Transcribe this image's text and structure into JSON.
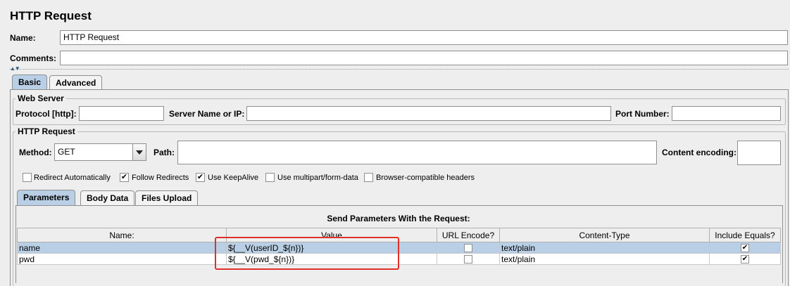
{
  "title": "HTTP Request",
  "name": {
    "label": "Name:",
    "value": "HTTP Request"
  },
  "comments": {
    "label": "Comments:",
    "value": ""
  },
  "tabs": [
    {
      "label": "Basic",
      "active": true
    },
    {
      "label": "Advanced",
      "active": false
    }
  ],
  "web_server": {
    "title": "Web Server",
    "protocol_label": "Protocol [http]:",
    "protocol_value": "",
    "server_label": "Server Name or IP:",
    "server_value": "",
    "port_label": "Port Number:",
    "port_value": ""
  },
  "http_request": {
    "title": "HTTP Request",
    "method_label": "Method:",
    "method_value": "GET",
    "path_label": "Path:",
    "path_value": "",
    "encoding_label": "Content encoding:",
    "encoding_value": ""
  },
  "options": [
    {
      "label": "Redirect Automatically",
      "checked": false
    },
    {
      "label": "Follow Redirects",
      "checked": true
    },
    {
      "label": "Use KeepAlive",
      "checked": true
    },
    {
      "label": "Use multipart/form-data",
      "checked": false
    },
    {
      "label": "Browser-compatible headers",
      "checked": false
    }
  ],
  "sub_tabs": [
    {
      "label": "Parameters",
      "active": true
    },
    {
      "label": "Body Data",
      "active": false
    },
    {
      "label": "Files Upload",
      "active": false
    }
  ],
  "params": {
    "heading": "Send Parameters With the Request:",
    "columns": [
      "Name:",
      "Value",
      "URL Encode?",
      "Content-Type",
      "Include Equals?"
    ],
    "rows": [
      {
        "name": "name",
        "value": "${__V(userID_${n})}",
        "url_encode": false,
        "content_type": "text/plain",
        "include_equals": true
      },
      {
        "name": "pwd",
        "value": "${__V(pwd_${n})}",
        "url_encode": false,
        "content_type": "text/plain",
        "include_equals": true
      }
    ]
  },
  "colors": {
    "selection": "#b8cfe5",
    "highlight": "#e0302a",
    "background": "#eeeeee"
  }
}
